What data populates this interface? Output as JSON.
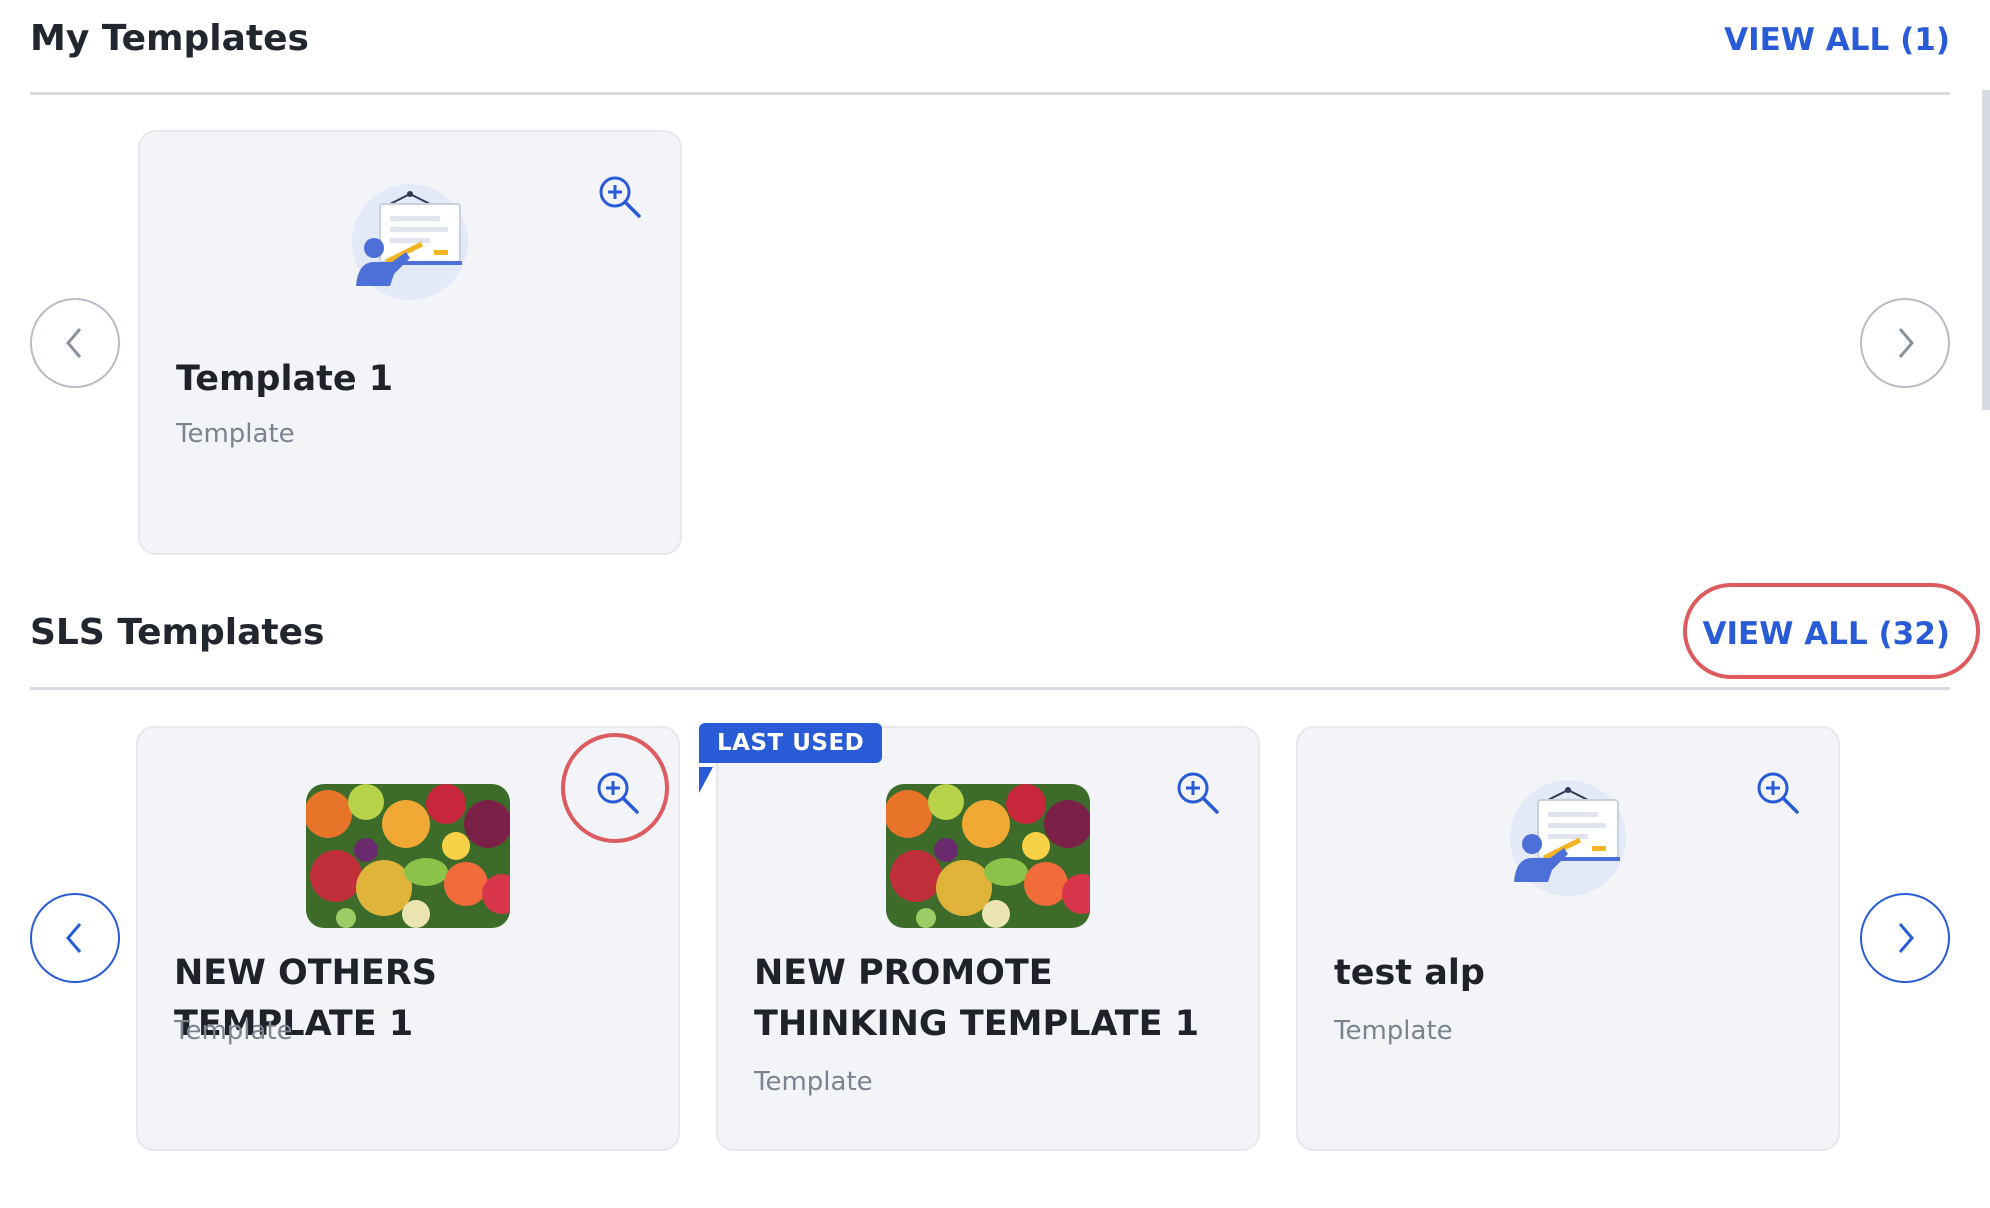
{
  "my_templates": {
    "title": "My Templates",
    "view_all": "VIEW ALL (1)",
    "cards": [
      {
        "title": "Template 1",
        "subtitle": "Template",
        "thumb": "teacher-whiteboard-icon"
      }
    ]
  },
  "sls_templates": {
    "title": "SLS Templates",
    "view_all": "VIEW ALL (32)",
    "badge": "LAST USED",
    "cards": [
      {
        "title": "NEW OTHERS TEMPLATE 1",
        "subtitle": "Template",
        "thumb": "fruits-photo"
      },
      {
        "title": "NEW PROMOTE THINKING TEMPLATE 1",
        "subtitle": "Template",
        "thumb": "fruits-photo"
      },
      {
        "title": "test alp",
        "subtitle": "Template",
        "thumb": "teacher-whiteboard-icon"
      }
    ]
  },
  "icons": {
    "zoom": "zoom-in-icon",
    "prev": "chevron-left-icon",
    "next": "chevron-right-icon"
  },
  "colors": {
    "accent": "#2a5bd7",
    "highlight_ring": "#dd5a5f",
    "card_bg": "#f3f4f8"
  }
}
